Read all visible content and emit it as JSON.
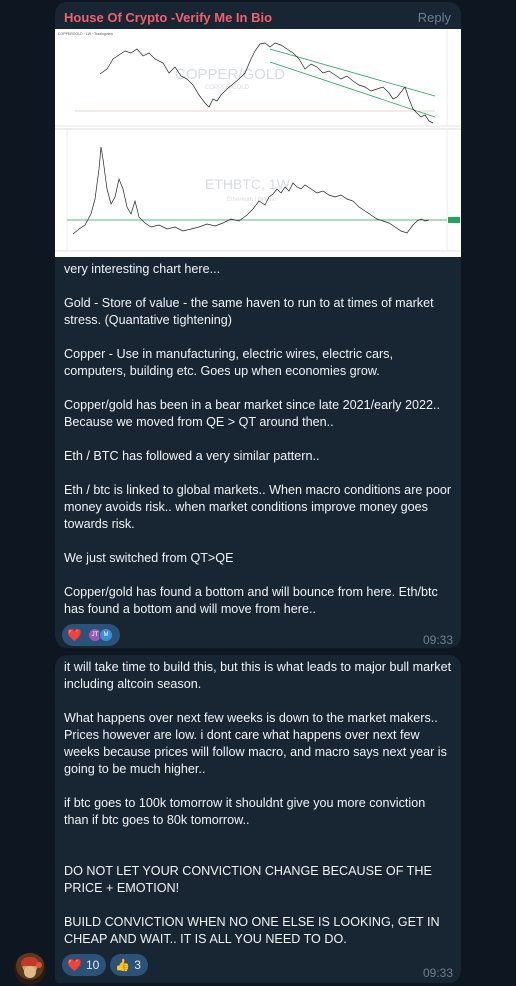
{
  "message1": {
    "sender": "House Of Crypto -Verify Me In Bio",
    "reply_label": "Reply",
    "chart_top": {
      "symbol_line": "COPPERGOLD · 1W · Tradingview",
      "watermark": "COPPER/GOLD",
      "sub_watermark": "COPPER/GOLD"
    },
    "chart_bottom": {
      "watermark": "ETHBTC, 1W",
      "sub_watermark": "Ethereum / Bitcoin"
    },
    "text": "very interesting chart here...\n\nGold - Store of value - the same haven to run to at times of market stress. (Quantative tightening)\n\nCopper - Use in manufacturing, electric wires, electric cars, computers, building etc. Goes up when economies grow.\n\nCopper/gold has been in a bear market since late 2021/early 2022.. Because we moved from QE > QT around then..\n\nEth / BTC has followed a very similar pattern..\n\nEth / btc is linked to global markets.. When macro conditions are poor money avoids risk.. when market conditions improve money goes towards risk.\n\nWe just switched from QT>QE\n\nCopper/gold has found a bottom and will bounce from here. Eth/btc has found a bottom and will move from here..",
    "reaction_emoji": "❤️",
    "reactor_initials": [
      "JT",
      "M"
    ],
    "reactor_colors": [
      "#9b59b6",
      "#3a8fd6"
    ],
    "time": "09:33"
  },
  "message2": {
    "text": "it will take time to build this, but this is what leads to major bull market including altcoin season.\n\nWhat happens over next few weeks is down to the market makers.. Prices however are low. i dont care what happens over next few weeks because prices will follow macro, and macro says next year is going to be much higher..\n\nif btc goes to 100k tomorrow it shouldnt give you more conviction than if btc goes to 80k tomorrow..\n\n\nDO NOT LET YOUR CONVICTION CHANGE BECAUSE OF THE PRICE + EMOTION!\n\nBUILD CONVICTION WHEN NO ONE ELSE IS LOOKING, GET IN CHEAP AND WAIT.. IT IS ALL YOU NEED TO DO.",
    "reactions": [
      {
        "emoji": "❤️",
        "count": "10"
      },
      {
        "emoji": "👍",
        "count": "3"
      }
    ],
    "time": "09:33"
  },
  "colors": {
    "bg": "#0e1621",
    "bubble": "#182533",
    "sender": "#f0616d",
    "chip": "#2b5278",
    "trend": "#22a35a"
  }
}
